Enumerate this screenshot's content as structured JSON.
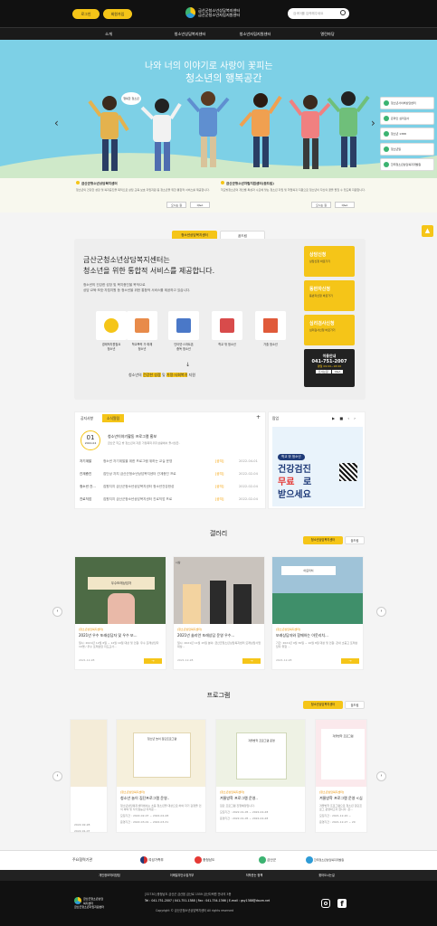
{
  "header": {
    "login": "로그인",
    "join": "회원가입",
    "logo_line1": "금산군청소년상담복지센터",
    "logo_line2": "금산군청소년자립지원센터",
    "search_placeholder": "검색어를 입력해주세요"
  },
  "gnb": [
    "소개",
    "청소년상담복지센터",
    "청소년자립지원센터",
    "열린마당"
  ],
  "hero": {
    "title1": "나와 너의 이야기로 사랑이 꽃피는",
    "title2": "청소년의 행복공간",
    "bubble": "행복한 청소년"
  },
  "quick": [
    "청소년사이버상담센터",
    "온라인 심리검사",
    "청소년 1388",
    "청소년일",
    "한국청소년상담복지개발원"
  ],
  "centers": [
    {
      "title": "금산군청소년상담복지센터",
      "desc": "청소년의 건강한 성장 및 복지증진을 목적으로 상담·교육·보호·자립지원 등 청소년을 위한 통합적 서비스를 제공합니다.",
      "b1": "오시는 길",
      "b2": "Q&A"
    },
    {
      "title": "금산군청소년자립지원센터(꿈드림)",
      "desc": "학교밖청소년의 개인별 특성과 수요에 맞는 청소년 자립 및 학업복귀 지원으로 청소년이 자신의 꿈을 펼칠 수 있도록 지원합니다.",
      "b1": "오시는 길",
      "b2": "Q&A"
    }
  ],
  "tabs": {
    "t1": "청소년상담복지센터",
    "t2": "꿈드림"
  },
  "intro": {
    "title": "금산군청소년상담복지센터는\n청소년을 위한 통합적 서비스를 제공합니다.",
    "desc": "청소년의 건강한 성장 및 복지증진을 목적으로\n상담·교육·보호·자립지원 등 청소년을 위한 통합적 서비스를 제공하고 있습니다.",
    "more": "더보기",
    "services": [
      "경제적지원필요\n청소년",
      "학교폭력 가·피해\n청소년",
      "인터넷·스마트폰\n중독 청소년",
      "학교 밖 청소년",
      "가출 청소년"
    ],
    "caption_a": "청소년의 ",
    "caption_b": "건강한 성장",
    "caption_c": " 및 ",
    "caption_d": "가정·사회복귀",
    "caption_e": " 지원",
    "side": [
      {
        "t": "상담신청",
        "s": "상담신청 바로가기"
      },
      {
        "t": "동반자신청",
        "s": "동반자신청 바로가기"
      },
      {
        "t": "심리검사신청",
        "s": "심리검사신청 바로가기"
      }
    ],
    "phone_label": "이용안내",
    "phone": "041-751-2007",
    "phone_desc": "평일 09:00~18:00",
    "phone_b1": "오시는길",
    "phone_b2": "Q&A"
  },
  "board": {
    "tab1": "공지사항",
    "tab2": "소식알림",
    "plus": "+",
    "featured_day": "01",
    "featured_ym": "2022-04",
    "featured_title": "청소년이야기활동 프로그램 홍보",
    "featured_desc": "금산군 학교 밖 청소년의 자존 가정폭력·위기상황에서 졸시월급..",
    "rows": [
      {
        "c": "자기계발",
        "t": "청소년 자기계발을 위한 프로그램 위하는 교실 운영",
        "tag": "[공지]",
        "d": "2022-04-01"
      },
      {
        "c": "관계증진",
        "t": "집단상 자치 금산군청소년상담복지센터 관계증진 프로",
        "tag": "[공지]",
        "d": "2022-02-04"
      },
      {
        "c": "청소년 건...",
        "t": "집원지지 금산군청소년상담복지센터 청소년건강한성",
        "tag": "[공지]",
        "d": "2022-02-04"
      },
      {
        "c": "진로직업",
        "t": "집원지지 금산군청소년상담복지센터 진로직업 프로",
        "tag": "[공지]",
        "d": "2022-02-04"
      }
    ]
  },
  "popup": {
    "title": "팝업",
    "badge": "학교 밖 청소년",
    "l1": "건강검진",
    "l2": "무료",
    "l3": "로",
    "l4": "받으세요"
  },
  "gallery": {
    "title": "갤러리",
    "tab1": "청소년상담복지센터",
    "tab2": "꿈드림",
    "cards": [
      {
        "tag": "[청소년상담복지센터]",
        "title": "2021년 우수 또래상담자 및 우수 또...",
        "desc": "일시: 2021년 12월 6일 ~ 12월 10일 대상 및 인원: 우수 또래상담자 10명 / 우수 또래상담 지도교사...",
        "date": "2021-12-28",
        "photo": "우수또래상담자"
      },
      {
        "tag": "[청소년상담복지센터]",
        "title": "2021년 솔리언 또래상담 운영 우수...",
        "desc": "일시: 2021년 11월 15일 분야: 금산군청소년상담복지센터 또래상담사업 대상...",
        "date": "2021-12-28",
        "photo": "시상"
      },
      {
        "tag": "[청소년상담복지센터]",
        "title": "또래상담자와 함께하는 아웃리치...",
        "desc": "기간: 2021년 9월 30일 ~ 10월 8일 대상 및 인원: 관내 초중고 또래상담자 위험 ...",
        "date": "2021-12-28",
        "photo": "아웃리치"
      }
    ]
  },
  "program": {
    "title": "프로그램",
    "tab1": "청소년상담복지센터",
    "tab2": "꿈드림",
    "partial_left": {
      "d1": "2022-02-28",
      "d2": "2022-01-07"
    },
    "cards": [
      {
        "tag": "[청소년상담복지센터]",
        "title": "청소년 놀이 집단프로그램 운영..",
        "desc": "청소년상담복지센터에서는 초등 청소년을 대상으로 하여 자기 감정을 인식 하며 및 자기효능감 자치운...",
        "d1": "모집기간 : 2022-02-07 ~ 2022-02-28",
        "d2": "운영기간 : 2022-03-01 ~ 2022-03-31",
        "poster": "청소년 놀이 집단프로그램"
      },
      {
        "tag": "[청소년상담복지센터]",
        "title": "겨울방학 프로그램 운영..",
        "desc": "집단 프로그램 진행예정입니다.",
        "d1": "모집기간 : 2022-01-05 ~ 2022-02-28",
        "d2": "운영기간 : 2022-01-05 ~ 2022-02-28",
        "poster": "겨울방학 프로그램 운영"
      },
      {
        "tag": "[청소년상담복지센터]",
        "title": "겨울방학 프로그램 운영 <심리...",
        "desc": "겨울방학 프로그램으로 청소년 집단프로그 운영하고자 합니다. 관...",
        "d1": "모집기간 : 2021-12-20 ~",
        "d2": "운영기간 : 2021-12-27 ~ 20",
        "poster": "겨울방학 프로그램"
      }
    ]
  },
  "partners": {
    "label": "주요협력기관",
    "items": [
      "여성가족부",
      "충청남도",
      "금산군",
      "한국청소년상담복지개발원"
    ]
  },
  "footer_nav": [
    "개인정보처리방침",
    "이메일무단수집거부",
    "저작권는 정책",
    "찾아오시는길"
  ],
  "footer": {
    "addr": "[32730] 충청남도 금산군 금산읍 금산로 1559 금산다락원 안내석 3층",
    "tel": "Tel : 041-751-2007 / 041-751-1388 | Fax : 041-754-1366 | E-mail : gsy1388@daum.net",
    "copy": "Copyright © 금산군청소년상담복지센터 All rights reserved",
    "logo1": "금산군청소년상담복지센터",
    "logo2": "금산군청소년자립지원센터"
  },
  "colors": {
    "accent": "#f5c518",
    "dark": "#111111",
    "sky": "#7dd0e6"
  }
}
